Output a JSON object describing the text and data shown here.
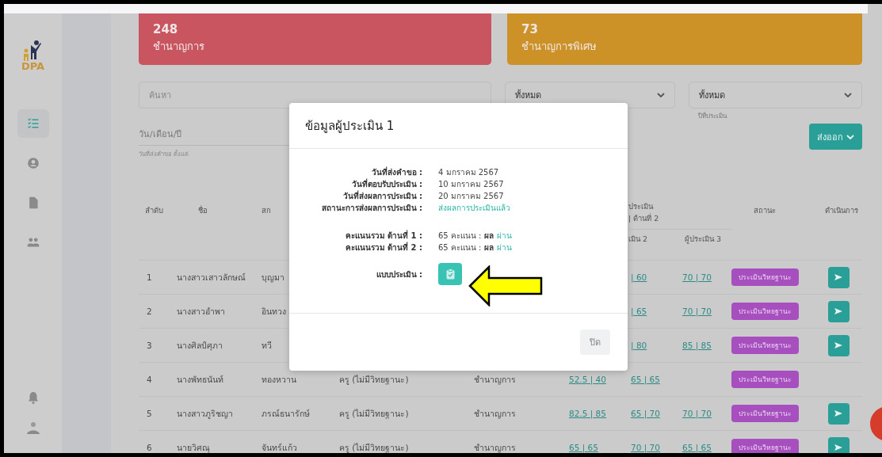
{
  "sidebar": {
    "logo_text": "DPA",
    "nav_items": [
      {
        "selected": true
      },
      {
        "selected": false
      },
      {
        "selected": false
      },
      {
        "selected": false
      }
    ]
  },
  "cards": [
    {
      "count": "248",
      "label": "ชำนาญการ",
      "color": "#c8555f"
    },
    {
      "count": "73",
      "label": "ชำนาญการพิเศษ",
      "color": "#cc9227"
    }
  ],
  "filters": {
    "search": {
      "placeholder": "ค้นหา"
    },
    "selects": [
      {
        "value": "ทั้งหมด"
      },
      {
        "value": "ทั้งหมด",
        "caption": "ปีที่ประเมิน"
      }
    ],
    "date": {
      "placeholder": "วัน/เดือน/ปี",
      "hint": "วันที่ส่งคำขอ ตั้งแต่"
    },
    "export_button": "ส่งออก"
  },
  "table": {
    "headers": {
      "number": "ลำดับ",
      "name": "ชื่อ",
      "surname": "สก",
      "score_group": "ประเมิน",
      "score_group_sub": "| ด้านที่ 2",
      "evaluator_2": "เมิน 2",
      "evaluator_3": "ผู้ประเมิน 3",
      "status": "สถานะ",
      "action": "ดำเนินการ"
    },
    "rows": [
      {
        "number": "1",
        "name": "นางสาวเสาวลักษณ์",
        "surname": "บุญมา",
        "evaluator_2": "| 60",
        "evaluator_3": "70 | 70",
        "status": "ประเมินวิทยฐานะ",
        "action_button": true
      },
      {
        "number": "2",
        "name": "นางสาวอำพา",
        "surname": "อินทวง",
        "evaluator_2": "| 65",
        "evaluator_3": "70 | 70",
        "status": "ประเมินวิทยฐานะ",
        "action_button": true
      },
      {
        "number": "3",
        "name": "นางศิลป์ศุภา",
        "surname": "ทวี",
        "evaluator_2": "| 80",
        "evaluator_3": "85 | 85",
        "status": "ประเมินวิทยฐานะ",
        "action_button": true
      },
      {
        "number": "4",
        "name": "นางพัทธนันท์",
        "surname": "ทองหวาน",
        "position": "ครู (ไม่มีวิทยฐานะ)",
        "rank": "ชำนาญการ",
        "evaluator_1": "52.5 | 40",
        "evaluator_2": "65 | 65",
        "status": "ประเมินวิทยฐานะ",
        "action_button": false
      },
      {
        "number": "5",
        "name": "นางสาวภูริชญา",
        "surname": "ภรณ์ธนารักษ์",
        "position": "ครู (ไม่มีวิทยฐานะ)",
        "rank": "ชำนาญการ",
        "evaluator_1": "82.5 | 85",
        "evaluator_2": "65 | 70",
        "evaluator_3": "70 | 70",
        "status": "ประเมินวิทยฐานะ",
        "action_button": true
      },
      {
        "number": "6",
        "name": "นายวิศณุ",
        "surname": "จันทร์แก้ว",
        "position": "ครู (ไม่มีวิทยฐานะ)",
        "rank": "ชำนาญการ",
        "evaluator_1": "65 | 65",
        "evaluator_2": "70 | 70",
        "evaluator_3": "65 | 65",
        "status": "ประเมินวิทยฐานะ",
        "action_button": true
      }
    ]
  },
  "modal": {
    "title": "ข้อมูลผู้ประเมิน 1",
    "details": [
      {
        "kind": "text",
        "label": "วันที่ส่งคำขอ :",
        "value": "4 มกราคม 2567"
      },
      {
        "kind": "text",
        "label": "วันที่ตอบรับประเมิน :",
        "value": "10 มกราคม 2567"
      },
      {
        "kind": "text",
        "label": "วันที่ส่งผลการประเมิน :",
        "value": "20 มกราคม 2567"
      },
      {
        "kind": "status",
        "label": "สถานะการส่งผลการประเมิน :",
        "value": "ส่งผลการประเมินแล้ว"
      },
      {
        "kind": "score",
        "label": "คะแนนรวม ด้านที่ 1 :",
        "value": "65 คะแนน : **ผล**",
        "result": "ผ่าน"
      },
      {
        "kind": "score",
        "label": "คะแนนรวม ด้านที่ 2 :",
        "value": "65 คะแนน : **ผล**",
        "result": "ผ่าน"
      },
      {
        "kind": "form",
        "label": "แบบประเมิน :"
      }
    ],
    "close_button": "ปิด"
  }
}
